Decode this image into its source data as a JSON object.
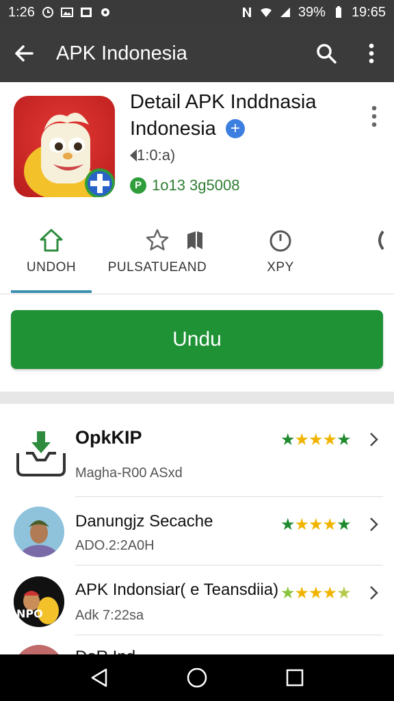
{
  "status_bar": {
    "time_left": "1:26",
    "battery": "39%",
    "clock": "19:65"
  },
  "toolbar": {
    "title": "APK Indonesia",
    "back_icon": "arrow-left-icon",
    "search_icon": "search-icon",
    "more_icon": "more-vert-icon"
  },
  "app": {
    "title": "Detail APK Inddnasia Indonesia",
    "version": "1:0:a)",
    "stat": "1o13 3g5008",
    "stat_badge": "P"
  },
  "tabs": [
    {
      "label": "UNDOH",
      "icon": "home-icon"
    },
    {
      "label": "PULSATUEAND",
      "icon": "star-icon"
    },
    {
      "label": "",
      "icon": "bookmark-icon"
    },
    {
      "label": "XPY",
      "icon": "timer-icon"
    },
    {
      "label": "",
      "icon": "more-tab-icon"
    }
  ],
  "download": {
    "label": "Undu",
    "color": "#1f9236"
  },
  "list": [
    {
      "title": "OpkKIP",
      "subtitle": "Magha-R00 ASxd",
      "stars": "★★★★★",
      "rating": 5
    },
    {
      "title": "Danungjz Secache",
      "subtitle": "ADO.2:2A0H",
      "stars": "★★★★★",
      "rating": 5
    },
    {
      "title": "APK Indonsiar( e Teansdiia)",
      "subtitle": "Adk 7:22sa",
      "stars": "★★★★★",
      "rating": 4.5
    },
    {
      "title": "DoR Ind...",
      "subtitle": "",
      "stars": "",
      "rating": 0
    }
  ],
  "nav": {
    "back": "nav-back-icon",
    "home": "nav-home-icon",
    "recents": "nav-recents-icon"
  }
}
